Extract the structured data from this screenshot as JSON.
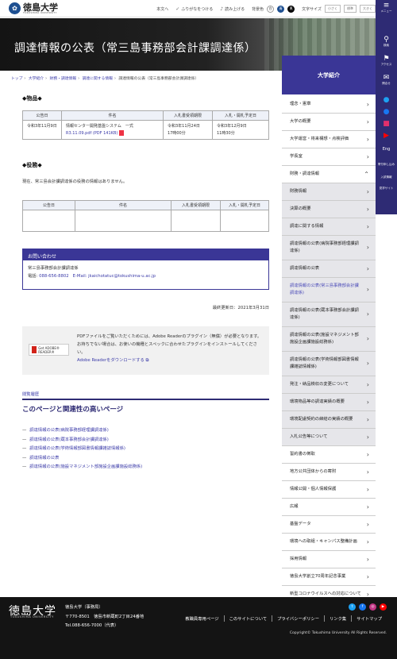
{
  "header": {
    "logo_jp": "徳島大学",
    "logo_en": "TOKUSHIMA UNIVERSITY",
    "skip": "本文へ",
    "furigana": "ふりがなをつける",
    "read_aloud": "読み上げる",
    "bg_label": "背景色",
    "bg_white": "白",
    "bg_blue": "青",
    "bg_black": "黒",
    "size_label": "文字サイズ",
    "size_small": "小さく",
    "size_std": "標準",
    "size_large": "大きく"
  },
  "rail": {
    "menu": "メニュー",
    "search": "検索",
    "access": "アクセス",
    "contact": "問合せ",
    "eng": "Eng",
    "donation": "寄付申し込み",
    "admission": "入試情報",
    "visit": "見学サイト"
  },
  "banner": {
    "title": "調達情報の公表（常三島事務部会計課調達係）"
  },
  "breadcrumb": [
    "トップ",
    "大学紹介",
    "財務・調達情報",
    "調達に関する情報",
    "調達情報の公表（常三島事務部会計課調達係）"
  ],
  "goods": {
    "heading": "◆物品◆",
    "headers": [
      "公告日",
      "件名",
      "入札書受領期限",
      "入札・開札予定日"
    ],
    "row": {
      "date": "令和3年11月9日",
      "subject": "情報センター開発基盤システム　一式",
      "pdf_link": "R3.11.09.pdf (PDF 141KB)",
      "deadline1": "令和3年11月24日",
      "deadline2": "17時00分",
      "opening1": "令和3年12月9日",
      "opening2": "11時30分"
    }
  },
  "services": {
    "heading": "◆役務◆",
    "none": "現在、常三島会計課調達係の役務の情報はありません。",
    "headers": [
      "公告日",
      "件名",
      "入札書受領期限",
      "入札・開札予定日"
    ]
  },
  "contact": {
    "title": "お問い合わせ",
    "dept": "常三島事務部会計課調達係",
    "tel_label": "電話:",
    "tel": "088-656-8802",
    "email": "E-Mail: jkaichotatuc@tokushima-u.ac.jp"
  },
  "updated": "最終更新日：2021年3月31日",
  "reader": {
    "logo_text": "Get ADOBE® READER®",
    "text": "PDFファイルをご覧いただくためには、Adobe Readerのプラグイン（無償）が必要となります。お持ちでない場合は、お使いの機種とスペックに合わせたプラグインをインストールしてください。",
    "link": "Adobe Readerをダウンロードする"
  },
  "related": {
    "tag": "閲覧履歴",
    "heading": "このページと関連性の高いページ",
    "items": [
      "調達情報の公表(病院事務部経理課調達係)",
      "調達情報の公表(蔵本事務部会計課調達係)",
      "調達情報の公表(学術情報部図書情報課雑誌情報係)",
      "調達情報の公表",
      "調達情報の公表(施設マネジメント部施設企画課施設総務係)"
    ]
  },
  "sidebar": {
    "title": "大学紹介",
    "items": [
      {
        "label": "理念・憲章",
        "chev": "›",
        "sub": false,
        "cur": false
      },
      {
        "label": "大学の概要",
        "chev": "›",
        "sub": false,
        "cur": false
      },
      {
        "label": "大学運営・将来構想・点検評価",
        "chev": "›",
        "sub": false,
        "cur": false
      },
      {
        "label": "学長室",
        "chev": "›",
        "sub": false,
        "cur": false
      },
      {
        "label": "財務・調達情報",
        "chev": "⌃",
        "sub": false,
        "cur": false
      },
      {
        "label": "財務情報",
        "chev": "›",
        "sub": true,
        "cur": false
      },
      {
        "label": "決算の概要",
        "chev": "›",
        "sub": true,
        "cur": false
      },
      {
        "label": "調達に関する情報",
        "chev": "›",
        "sub": true,
        "cur": false
      },
      {
        "label": "調達情報の公表(病院事務部経理課調達係)",
        "chev": "›",
        "sub": true,
        "cur": false
      },
      {
        "label": "調達情報の公表",
        "chev": "›",
        "sub": true,
        "cur": false
      },
      {
        "label": "調達情報の公表(常三島事務部会計課調達係)",
        "chev": "›",
        "sub": true,
        "cur": true
      },
      {
        "label": "調達情報の公表(蔵本事務部会計課調達係)",
        "chev": "›",
        "sub": true,
        "cur": false
      },
      {
        "label": "調達情報の公表(施設マネジメント部施設企画課施設総務係)",
        "chev": "›",
        "sub": true,
        "cur": false
      },
      {
        "label": "調達情報の公表(学術情報部図書情報課雑誌情報係)",
        "chev": "›",
        "sub": true,
        "cur": false
      },
      {
        "label": "発注・納品検収の変更について",
        "chev": "›",
        "sub": true,
        "cur": false
      },
      {
        "label": "環境物品等の調達実績の概要",
        "chev": "›",
        "sub": true,
        "cur": false
      },
      {
        "label": "環境配慮契約の締結の実績の概要",
        "chev": "›",
        "sub": true,
        "cur": false
      },
      {
        "label": "入札公告等について",
        "chev": "›",
        "sub": true,
        "cur": false
      },
      {
        "label": "誓約書の徴取",
        "chev": "›",
        "sub": false,
        "cur": false
      },
      {
        "label": "地方公共団体からの寄附",
        "chev": "›",
        "sub": false,
        "cur": false
      },
      {
        "label": "情報公開・個人情報保護",
        "chev": "›",
        "sub": false,
        "cur": false
      },
      {
        "label": "広報",
        "chev": "›",
        "sub": false,
        "cur": false
      },
      {
        "label": "基盤データ",
        "chev": "›",
        "sub": false,
        "cur": false
      },
      {
        "label": "環境への取組・キャンパス整備計画",
        "chev": "›",
        "sub": false,
        "cur": false
      },
      {
        "label": "採用情報",
        "chev": "›",
        "sub": false,
        "cur": false
      },
      {
        "label": "徳島大学創立70周年記念事業",
        "chev": "›",
        "sub": false,
        "cur": false
      },
      {
        "label": "新型コロナウイルスへの対応について",
        "chev": "›",
        "sub": false,
        "cur": false
      }
    ]
  },
  "footer": {
    "logo_jp": "徳島大学",
    "logo_en": "TOKUSHIMA UNIVERSITY",
    "name": "徳島大学（事務局）",
    "address": "〒770-8501　徳島市新蔵町2丁目24番地",
    "tel": "Tel.088-656-7000（代表）",
    "links": [
      "教職員専用ページ",
      "このサイトについて",
      "プライバシーポリシー",
      "リンク集",
      "サイトマップ"
    ],
    "copyright": "Copyright© Tokushima University All Rights Reserved."
  },
  "colors": {
    "primary": "#2e2b74",
    "accent": "#3a3696",
    "link": "#3a3aa8"
  }
}
